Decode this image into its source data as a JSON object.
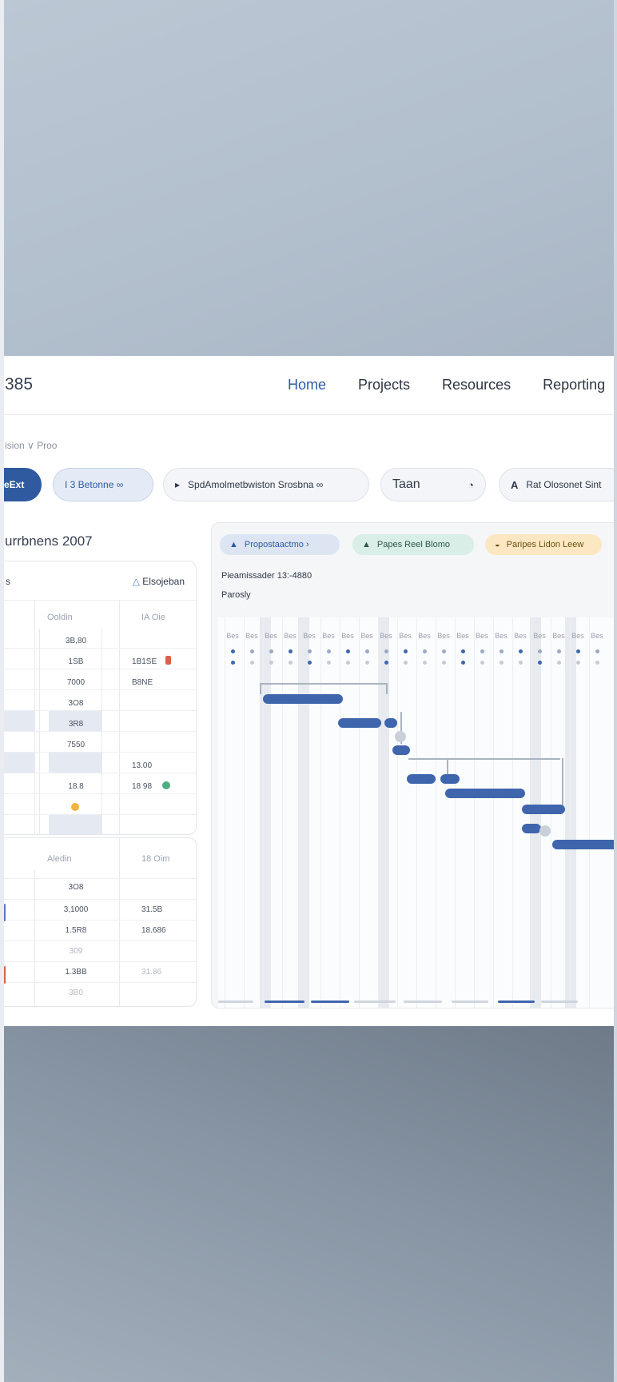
{
  "header": {
    "logo": "385",
    "nav": [
      {
        "label": "Home",
        "active": true
      },
      {
        "label": "Projects"
      },
      {
        "label": "Resources"
      },
      {
        "label": "Reporting"
      }
    ]
  },
  "breadcrumb": "ision  ∨  Proo",
  "toolbar": {
    "primary_label": "eExt",
    "selector_label": "I 3 Betonne ∞",
    "search_label": "SpdAmolmetbwiston Srosbna ∞",
    "team_label": "Taan",
    "owner_label": "Rat Olosonet Sint"
  },
  "left_panel": {
    "title": "urrbnens 2007",
    "card1": {
      "head": "s",
      "link": "Elsojeban",
      "col1": "Ooldin",
      "col2": "IA Oie",
      "rows": [
        {
          "v1": "3B,80",
          "v2": ""
        },
        {
          "v1": "1SB",
          "v2": "1B1SE",
          "flag": "red"
        },
        {
          "v1": "7000",
          "v2": "B8NE"
        },
        {
          "v1": "3O8",
          "v2": ""
        },
        {
          "v1": "3R8",
          "v2": ""
        },
        {
          "v1": "7550",
          "v2": ""
        },
        {
          "v1": "",
          "v2": "13.00"
        },
        {
          "v1": "18.8",
          "v2": "18 98",
          "flag": "green"
        },
        {
          "v1": "",
          "v2": ""
        }
      ]
    },
    "card2": {
      "col1": "Aledin",
      "col2": "18 Oim",
      "rows": [
        {
          "v1": "3O8",
          "v2": ""
        },
        {
          "v1": "3,1000",
          "v2": "31.5B"
        },
        {
          "v1": "1.5R8",
          "v2": "18.686"
        },
        {
          "v1": "309",
          "v2": ""
        },
        {
          "v1": "1.3BB",
          "v2": "31.86"
        },
        {
          "v1": "3B0",
          "v2": ""
        }
      ]
    }
  },
  "gantt": {
    "chips": [
      {
        "label": "Propostaactmo ›",
        "icon": "person-icon"
      },
      {
        "label": "Papes Reel Blomo",
        "icon": "person-icon"
      },
      {
        "label": "Paripes Lidon Leew",
        "icon": "bell-icon"
      }
    ],
    "title": "Pieamissader 13:-4880",
    "subtitle": "Parosly",
    "time_labels": [
      "Bes",
      "Bes",
      "Bes",
      "Bes",
      "Bes",
      "Bes",
      "Bes",
      "Bes",
      "Bes",
      "Bes",
      "Bes",
      "Bes",
      "Bes",
      "Bes",
      "Bes",
      "Bes",
      "Bes",
      "Bes",
      "Bes",
      "Bes"
    ]
  },
  "colors": {
    "accent": "#2f5aa0",
    "bar": "#3f66ad",
    "green": "#4fae80",
    "red": "#d9604f",
    "amber": "#f3b33d"
  }
}
